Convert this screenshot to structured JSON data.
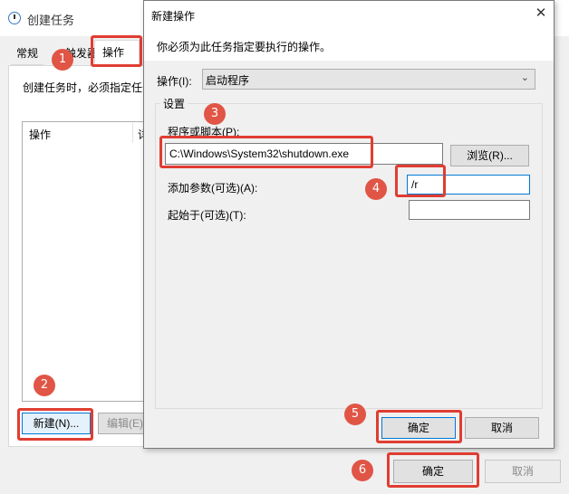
{
  "background_window": {
    "title": "创建任务",
    "tabs": [
      "常规",
      "触发器",
      "操作"
    ],
    "description": "创建任务时，必须指定任务",
    "list_columns": [
      "操作",
      "详"
    ],
    "new_button": "新建(N)...",
    "edit_button": "编辑(E)",
    "ok_button": "确定",
    "cancel_button": "取消"
  },
  "dialog": {
    "title": "新建操作",
    "close": "✕",
    "instruction": "你必须为此任务指定要执行的操作。",
    "action_label": "操作(I):",
    "action_value": "启动程序",
    "settings_legend": "设置",
    "program_label": "程序或脚本(P):",
    "program_value": "C:\\Windows\\System32\\shutdown.exe",
    "browse_button": "浏览(R)...",
    "args_label": "添加参数(可选)(A):",
    "args_value": "/r",
    "startin_label": "起始于(可选)(T):",
    "startin_value": "",
    "ok_button": "确定",
    "cancel_button": "取消"
  },
  "markers": [
    "1",
    "2",
    "3",
    "4",
    "5",
    "6"
  ],
  "colors": {
    "highlight": "#e03d32",
    "marker": "#e05545",
    "focus": "#0078d7"
  },
  "icons": {
    "window_icon": "task-scheduler-clock-icon",
    "dropdown": "chevron-down-icon"
  }
}
